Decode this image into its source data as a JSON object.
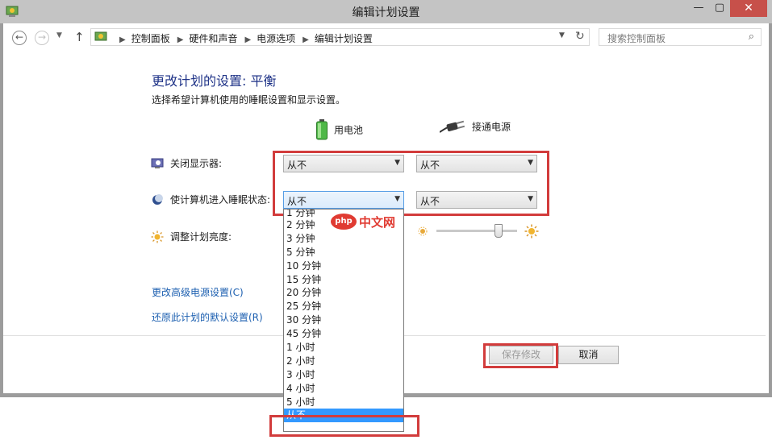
{
  "window": {
    "title": "编辑计划设置",
    "minimize": "—",
    "maximize": "▢",
    "close": "✕"
  },
  "nav": {
    "back": "←",
    "forward": "→",
    "history": "▼",
    "up": "↑",
    "breadcrumb": [
      "控制面板",
      "硬件和声音",
      "电源选项",
      "编辑计划设置"
    ],
    "breadcrumb_sep": "▶",
    "dropdown": "▼",
    "refresh": "↻"
  },
  "search": {
    "placeholder": "搜索控制面板",
    "icon": "⌕"
  },
  "page": {
    "heading": "更改计划的设置: 平衡",
    "subtext": "选择希望计算机使用的睡眠设置和显示设置。",
    "col_battery": "用电池",
    "col_plugged": "接通电源"
  },
  "rows": {
    "display": {
      "label": "关闭显示器:",
      "battery": "从不",
      "plugged": "从不"
    },
    "sleep": {
      "label": "使计算机进入睡眠状态:",
      "battery": "从不",
      "plugged": "从不"
    },
    "brightness": {
      "label": "调整计划亮度:",
      "battery_level": 0.2,
      "plugged_level": 0.8
    }
  },
  "links": {
    "advanced": "更改高级电源设置(C)",
    "restore": "还原此计划的默认设置(R)"
  },
  "buttons": {
    "save": "保存修改",
    "cancel": "取消"
  },
  "dropdown": {
    "options": [
      "1 分钟",
      "2 分钟",
      "3 分钟",
      "5 分钟",
      "10 分钟",
      "15 分钟",
      "20 分钟",
      "25 分钟",
      "30 分钟",
      "45 分钟",
      "1 小时",
      "2 小时",
      "3 小时",
      "4 小时",
      "5 小时",
      "从不"
    ],
    "selected": "从不"
  },
  "watermark": {
    "logo": "php",
    "text": "中文网"
  },
  "colors": {
    "highlight": "#d23c3c",
    "selected": "#3399ff",
    "heading": "#1e3287",
    "link": "#1c5fb0"
  }
}
